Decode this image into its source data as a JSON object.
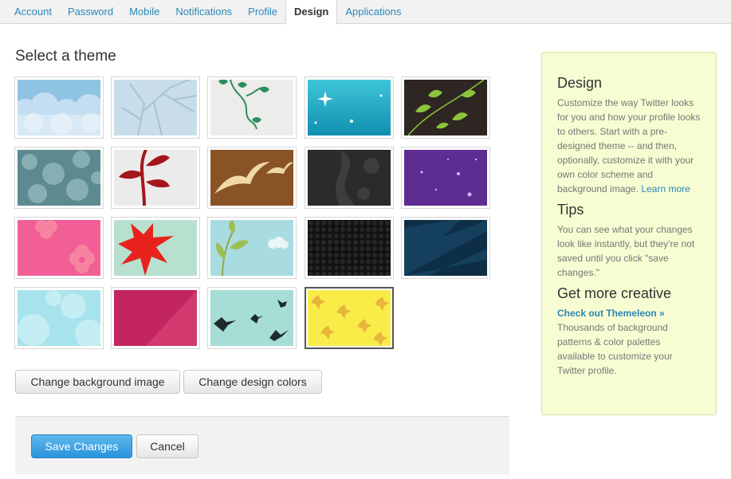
{
  "tabs": [
    {
      "label": "Account"
    },
    {
      "label": "Password"
    },
    {
      "label": "Mobile"
    },
    {
      "label": "Notifications"
    },
    {
      "label": "Profile"
    },
    {
      "label": "Design",
      "active": true
    },
    {
      "label": "Applications"
    }
  ],
  "main": {
    "title": "Select a theme",
    "themes": [
      {
        "icon": "clouds-theme-icon"
      },
      {
        "icon": "bare-tree-theme-icon"
      },
      {
        "icon": "vine-theme-icon"
      },
      {
        "icon": "sparkle-theme-icon"
      },
      {
        "icon": "green-leaves-theme-icon"
      },
      {
        "icon": "foliage-theme-icon"
      },
      {
        "icon": "red-plant-theme-icon"
      },
      {
        "icon": "cream-birds-theme-icon"
      },
      {
        "icon": "dark-grunge-theme-icon"
      },
      {
        "icon": "purple-stars-theme-icon"
      },
      {
        "icon": "pink-flowers-theme-icon"
      },
      {
        "icon": "red-leaf-theme-icon"
      },
      {
        "icon": "sprout-clouds-theme-icon"
      },
      {
        "icon": "hex-pattern-theme-icon"
      },
      {
        "icon": "navy-rays-theme-icon"
      },
      {
        "icon": "bubbles-theme-icon"
      },
      {
        "icon": "magenta-theme-icon"
      },
      {
        "icon": "black-birds-theme-icon"
      },
      {
        "icon": "yellow-leaves-theme-icon",
        "selected": true
      }
    ],
    "change_background_label": "Change background image",
    "change_colors_label": "Change design colors",
    "save_label": "Save Changes",
    "cancel_label": "Cancel"
  },
  "sidebar": {
    "design_title": "Design",
    "design_text": "Customize the way Twitter looks for you and how your profile looks to others. Start with a pre-designed theme -- and then, optionally, customize it with your own color scheme and background image.",
    "learn_more": "Learn more",
    "tips_title": "Tips",
    "tips_text": "You can see what your changes look like instantly, but they're not saved until you click \"save changes.\"",
    "creative_title": "Get more creative",
    "themeleon_link": "Check out Themeleon »",
    "creative_text": "Thousands of background patterns & color palettes available to customize your Twitter profile."
  },
  "colors": {
    "link": "#2a87b8",
    "sidebar_bg": "#f7fcd2",
    "primary_button": "#2a93da"
  }
}
